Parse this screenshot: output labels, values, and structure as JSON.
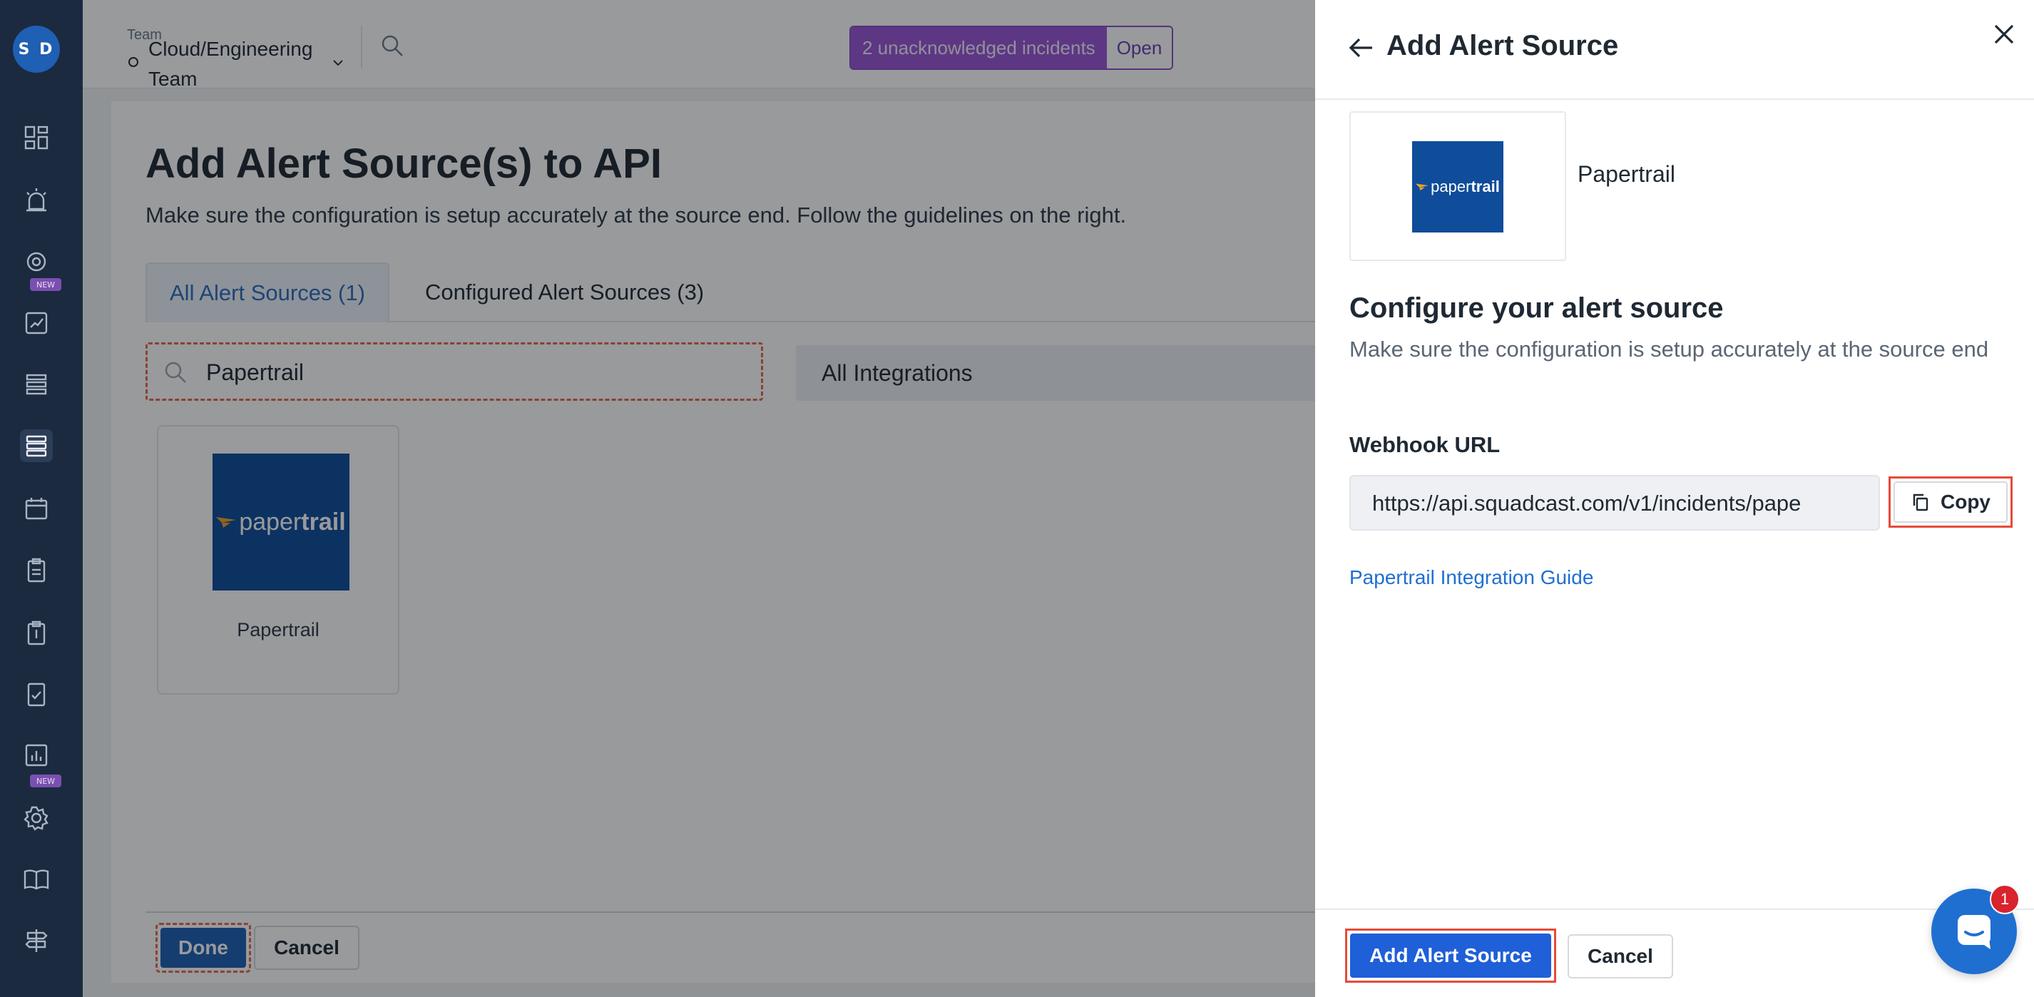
{
  "user": {
    "initials": "S D"
  },
  "sidebar": {
    "new_badge": "NEW",
    "items": [
      {
        "icon": "dashboard-icon"
      },
      {
        "icon": "incident-alarm-icon"
      },
      {
        "icon": "eye-icon",
        "badge": "NEW"
      },
      {
        "icon": "analytics-icon"
      },
      {
        "icon": "list-icon"
      },
      {
        "icon": "services-icon",
        "active": true
      },
      {
        "icon": "calendar-icon"
      },
      {
        "icon": "clipboard-icon"
      },
      {
        "icon": "runbook-icon"
      },
      {
        "icon": "postmortem-icon"
      },
      {
        "icon": "reports-icon",
        "badge": "NEW"
      },
      {
        "icon": "gear-icon"
      },
      {
        "icon": "book-icon"
      },
      {
        "icon": "signpost-icon"
      }
    ]
  },
  "topbar": {
    "team_label": "Team",
    "team_name": "Cloud/Engineering Team",
    "incident_count": "2 unacknowledged incidents",
    "incident_open": "Open"
  },
  "main": {
    "title": "Add Alert Source(s) to API",
    "subtitle": "Make sure the configuration is setup accurately at the source end. Follow the guidelines on the right.",
    "tabs": [
      {
        "label": "All Alert Sources (1)",
        "active": true
      },
      {
        "label": "Configured Alert Sources (3)",
        "active": false
      }
    ],
    "search_value": "Papertrail",
    "integration_filter": "All Integrations",
    "source_card": {
      "name": "Papertrail",
      "logo_text_light": "paper",
      "logo_text_bold": "trail"
    },
    "done_label": "Done",
    "cancel_label": "Cancel"
  },
  "drawer": {
    "title": "Add Alert Source",
    "source_name": "Papertrail",
    "logo_text_light": "paper",
    "logo_text_bold": "trail",
    "configure_title": "Configure your alert source",
    "configure_desc": "Make sure the configuration is setup accurately at the source end",
    "webhook_label": "Webhook URL",
    "webhook_url": "https://api.squadcast.com/v1/incidents/pape",
    "copy_label": "Copy",
    "guide_link": "Papertrail Integration Guide",
    "add_label": "Add Alert Source",
    "cancel_label": "Cancel"
  },
  "chat": {
    "unread": "1"
  },
  "colors": {
    "sidebar": "#1b2a3f",
    "primary": "#1f5fd8",
    "incident": "#9a55d6",
    "highlight": "#e84a3a",
    "papertrail": "#0f4c9a"
  }
}
